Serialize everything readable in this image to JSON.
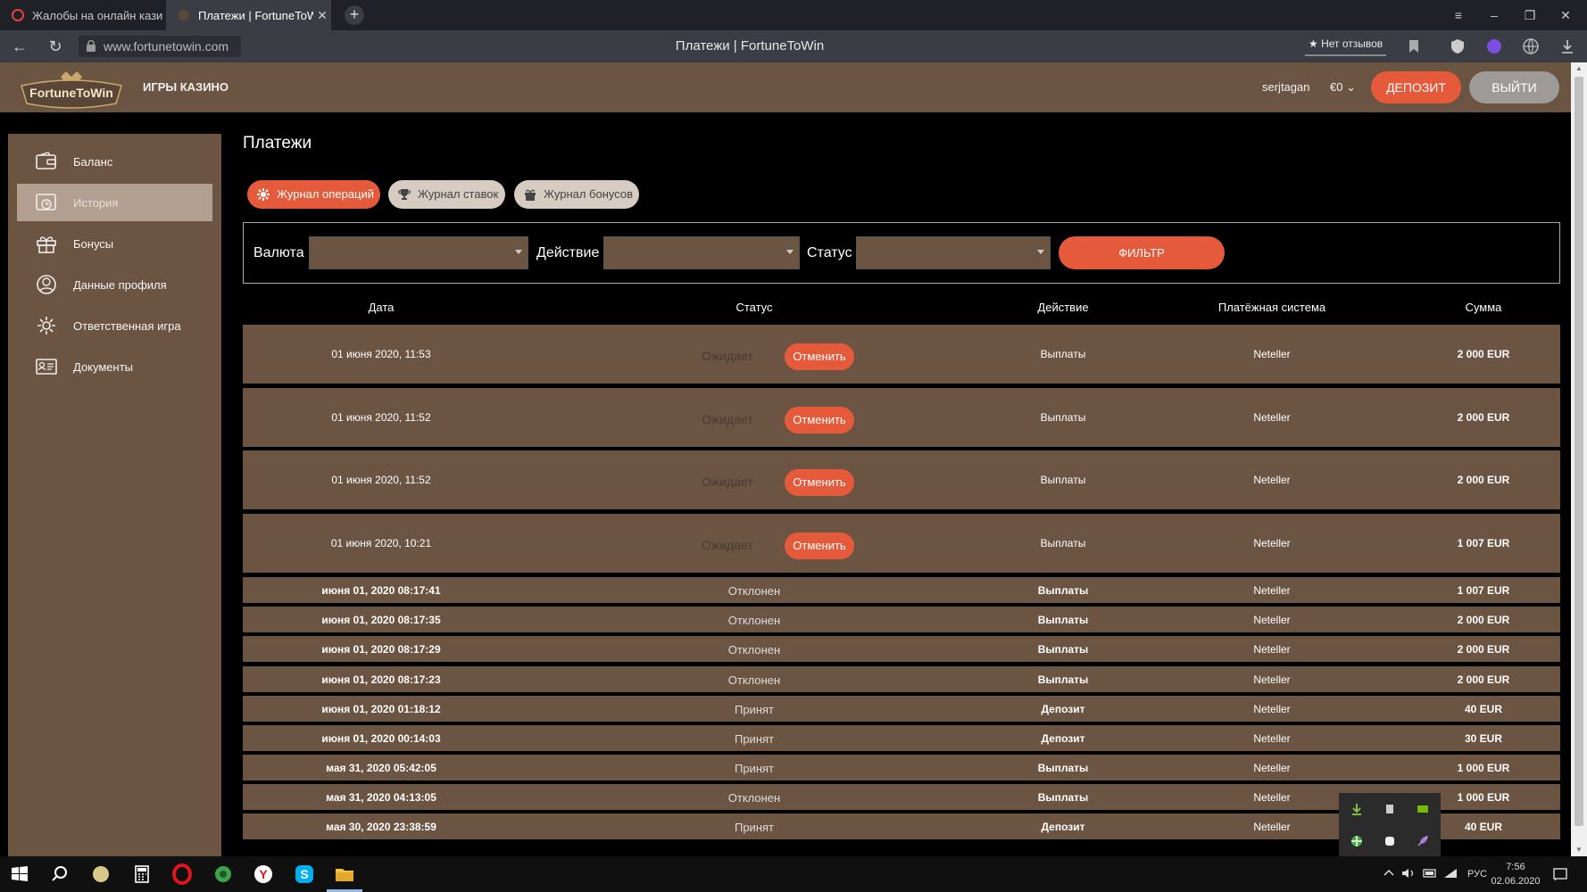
{
  "browser": {
    "tabs": [
      {
        "label": "Жалобы на онлайн казин",
        "active": false
      },
      {
        "label": "Платежи | FortuneToWi",
        "active": true
      }
    ],
    "url": "www.fortunetowin.com",
    "page_title": "Платежи | FortuneToWin",
    "reviews": "★ Нет отзывов"
  },
  "header": {
    "logo_text": "FortuneToWin",
    "games_link": "ИГРЫ КАЗИНО",
    "username": "serjtagan",
    "currency": "€0 ⌄",
    "deposit_label": "ДЕПОЗИТ",
    "logout_label": "ВЫЙТИ"
  },
  "sidebar": {
    "items": [
      {
        "label": "Баланс",
        "icon": "wallet-icon"
      },
      {
        "label": "История",
        "icon": "history-icon",
        "active": true
      },
      {
        "label": "Бонусы",
        "icon": "gift-icon"
      },
      {
        "label": "Данные профиля",
        "icon": "profile-icon"
      },
      {
        "label": "Ответственная игра",
        "icon": "gear-icon"
      },
      {
        "label": "Документы",
        "icon": "id-card-icon"
      }
    ]
  },
  "main": {
    "heading": "Платежи",
    "tabs": [
      {
        "label": "Журнал операций",
        "icon": "gear-icon",
        "active": true
      },
      {
        "label": "Журнал ставок",
        "icon": "trophy-icon"
      },
      {
        "label": "Журнал бонусов",
        "icon": "gift-icon"
      }
    ],
    "filter": {
      "currency_label": "Валюта",
      "action_label": "Действие",
      "status_label": "Статус",
      "button_label": "ФИЛЬТР"
    },
    "table": {
      "headers": [
        "Дата",
        "Статус",
        "Действие",
        "Платёжная система",
        "Сумма"
      ],
      "cancel_label": "Отменить",
      "pending_rows": [
        {
          "date": "01 июня 2020, 11:53",
          "status": "Ожидает",
          "action": "Выплаты",
          "system": "Neteller",
          "amount": "2 000 EUR"
        },
        {
          "date": "01 июня 2020, 11:52",
          "status": "Ожидает",
          "action": "Выплаты",
          "system": "Neteller",
          "amount": "2 000 EUR"
        },
        {
          "date": "01 июня 2020, 11:52",
          "status": "Ожидает",
          "action": "Выплаты",
          "system": "Neteller",
          "amount": "2 000 EUR"
        },
        {
          "date": "01 июня 2020, 10:21",
          "status": "Ожидает",
          "action": "Выплаты",
          "system": "Neteller",
          "amount": "1 007 EUR"
        }
      ],
      "rows": [
        {
          "date": "июня 01, 2020 08:17:41",
          "status": "Отклонен",
          "action": "Выплаты",
          "system": "Neteller",
          "amount": "1 007 EUR"
        },
        {
          "date": "июня 01, 2020 08:17:35",
          "status": "Отклонен",
          "action": "Выплаты",
          "system": "Neteller",
          "amount": "2 000 EUR"
        },
        {
          "date": "июня 01, 2020 08:17:29",
          "status": "Отклонен",
          "action": "Выплаты",
          "system": "Neteller",
          "amount": "2 000 EUR"
        },
        {
          "date": "июня 01, 2020 08:17:23",
          "status": "Отклонен",
          "action": "Выплаты",
          "system": "Neteller",
          "amount": "2 000 EUR"
        },
        {
          "date": "июня 01, 2020 01:18:12",
          "status": "Принят",
          "action": "Депозит",
          "system": "Neteller",
          "amount": "40 EUR"
        },
        {
          "date": "июня 01, 2020 00:14:03",
          "status": "Принят",
          "action": "Депозит",
          "system": "Neteller",
          "amount": "30 EUR"
        },
        {
          "date": "мая 31, 2020 05:42:05",
          "status": "Принят",
          "action": "Выплаты",
          "system": "Neteller",
          "amount": "1 000 EUR"
        },
        {
          "date": "мая 31, 2020 04:13:05",
          "status": "Отклонен",
          "action": "Выплаты",
          "system": "Neteller",
          "amount": "1 000 EUR"
        },
        {
          "date": "мая 30, 2020 23:38:59",
          "status": "Принят",
          "action": "Депозит",
          "system": "Neteller",
          "amount": "40 EUR"
        }
      ]
    }
  },
  "taskbar": {
    "lang": "РУС",
    "time": "7:56",
    "date": "02.06.2020"
  },
  "colors": {
    "accent": "#e45a3a",
    "brown": "#6c5443",
    "active_sidebar": "#b29f8f",
    "pill_inactive": "#d7ccc2"
  }
}
